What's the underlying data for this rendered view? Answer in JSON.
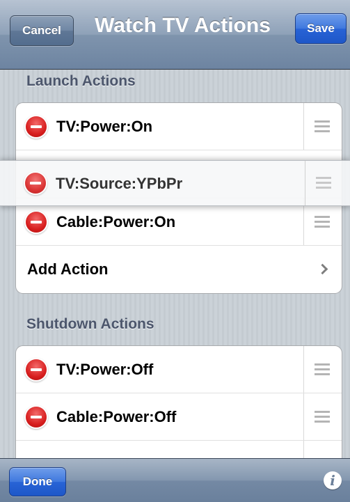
{
  "nav": {
    "title": "Watch TV Actions",
    "cancel_label": "Cancel",
    "save_label": "Save"
  },
  "launch": {
    "header": "Launch Actions",
    "items": [
      {
        "label": "TV:Power:On"
      },
      {
        "label": "Cable:Power:On"
      }
    ],
    "add_label": "Add Action"
  },
  "dragging": {
    "label": "TV:Source:YPbPr"
  },
  "shutdown": {
    "header": "Shutdown Actions",
    "items": [
      {
        "label": "TV:Power:Off"
      },
      {
        "label": "Cable:Power:Off"
      }
    ]
  },
  "toolbar": {
    "done_label": "Done",
    "info_icon": "i"
  },
  "colors": {
    "delete_red": "#d81f1f",
    "save_blue": "#2863d6",
    "section_header": "#4c566c"
  },
  "icons": {
    "delete": "minus-circle-icon",
    "reorder": "reorder-grip-icon",
    "disclosure": "chevron-right-icon",
    "info": "info-icon"
  }
}
